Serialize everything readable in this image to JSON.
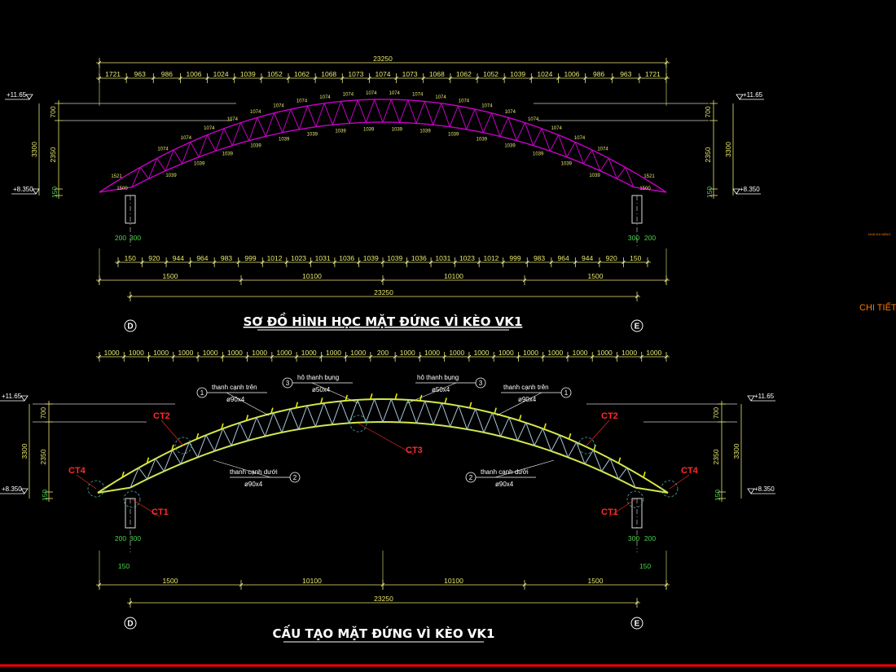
{
  "titles": {
    "top": "SƠ ĐỒ HÌNH HỌC MẶT ĐỨNG VÌ KÈO VK1",
    "bottom": "CẤU TẠO MẶT ĐỨNG VÌ KÈO VK1"
  },
  "side_note": "CHI TIẾT",
  "side_note_small": "NHÀ ĐA NĂNG",
  "levels": {
    "top": "+11.65",
    "bottom": "+8.350"
  },
  "axes": {
    "left": "D",
    "right": "E"
  },
  "top_diagram": {
    "overall": "23250",
    "top_segments": [
      "1721",
      "963",
      "986",
      "1006",
      "1024",
      "1039",
      "1052",
      "1062",
      "1068",
      "1073",
      "1074",
      "1073",
      "1068",
      "1062",
      "1052",
      "1039",
      "1024",
      "1006",
      "986",
      "963",
      "1721"
    ],
    "bottom_segments": [
      "150",
      "920",
      "944",
      "964",
      "983",
      "999",
      "1012",
      "1023",
      "1031",
      "1036",
      "1039",
      "1039",
      "1036",
      "1031",
      "1023",
      "1012",
      "999",
      "983",
      "964",
      "944",
      "920",
      "150"
    ],
    "bottom_overall": [
      "1500",
      "10100",
      "10100",
      "1500"
    ],
    "vertical": [
      "700",
      "3300",
      "2350",
      "150"
    ],
    "column": [
      "200",
      "300"
    ],
    "column_r": [
      "300",
      "200"
    ],
    "upper_chord_labels": [
      "1074",
      "1074",
      "1074",
      "1074",
      "1074",
      "1074",
      "1074",
      "1074",
      "1074",
      "1074",
      "1074",
      "1074",
      "1074",
      "1074",
      "1074",
      "1074",
      "1074",
      "1074",
      "1074",
      "1074"
    ],
    "lower_chord_labels": [
      "1039",
      "1039",
      "1039",
      "1039",
      "1039",
      "1039",
      "1039",
      "1039",
      "1039",
      "1039",
      "1039",
      "1039",
      "1039",
      "1039",
      "1039",
      "1039"
    ],
    "end_labels": [
      "1500",
      "1500",
      "1521",
      "1521"
    ]
  },
  "bottom_diagram": {
    "top_segments": [
      "1000",
      "1000",
      "1000",
      "1000",
      "1000",
      "1000",
      "1000",
      "1000",
      "1000",
      "1000",
      "1000",
      "200",
      "1000",
      "1000",
      "1000",
      "1000",
      "1000",
      "1000",
      "1000",
      "1000",
      "1000",
      "1000",
      "1000"
    ],
    "overall": "23250",
    "bottom_overall": [
      "1500",
      "10100",
      "10100",
      "1500"
    ],
    "vertical": [
      "700",
      "3300",
      "2350",
      "150"
    ],
    "column": [
      "200",
      "300"
    ],
    "column_r": [
      "300",
      "200"
    ],
    "post": "150",
    "callouts": [
      {
        "num": "1",
        "label": "thanh cạnh trên",
        "spec": "ø90x4"
      },
      {
        "num": "3",
        "label": "hô thanh bụng",
        "spec": "ø50x4"
      },
      {
        "num": "3",
        "label": "hô thanh bụng",
        "spec": "ø50x4"
      },
      {
        "num": "1",
        "label": "thanh cạnh trên",
        "spec": "ø90x4"
      },
      {
        "num": "2",
        "label": "thanh cạnh dưới",
        "spec": "ø90x4"
      },
      {
        "num": "2",
        "label": "thanh cạnh dưới",
        "spec": "ø90x4"
      }
    ],
    "details": [
      "CT2",
      "CT2",
      "CT3",
      "CT4",
      "CT4",
      "CT1",
      "CT1"
    ]
  },
  "colors": {
    "truss_top": "#c800c8",
    "truss_bottom": "#d4e84a",
    "web_bottom": "#a9c6d8",
    "dim": "#e8e870",
    "green": "#4fd34f",
    "red_line": "#ff0000"
  }
}
